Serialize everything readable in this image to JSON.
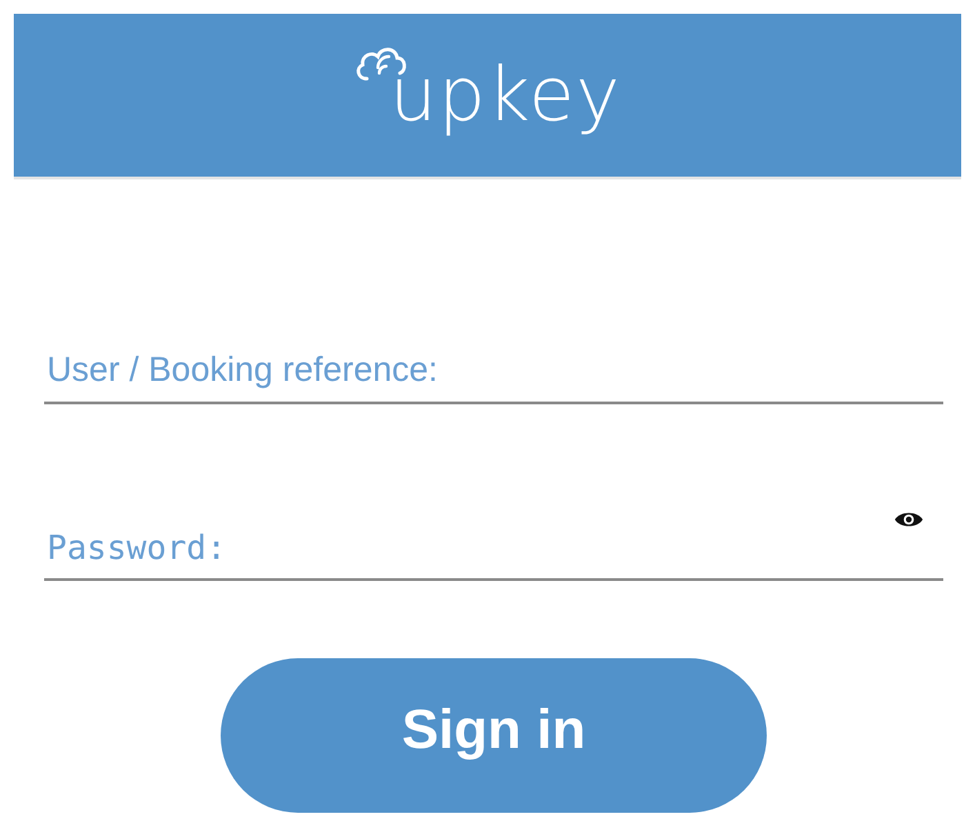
{
  "header": {
    "logo_text": "upkey"
  },
  "fields": [
    {
      "placeholder": "User / Booking reference:",
      "kind": "text"
    },
    {
      "placeholder": "Password:",
      "kind": "password"
    }
  ],
  "sign_in_button": {
    "label": "Sign in"
  }
}
